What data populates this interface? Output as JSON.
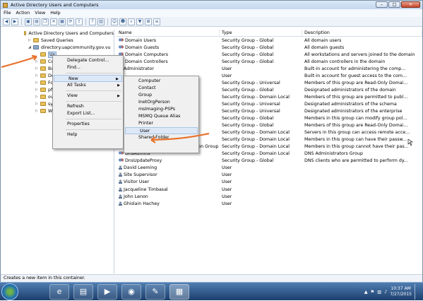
{
  "window": {
    "title": "Active Directory Users and Computers",
    "btn_min": "–",
    "btn_max": "□",
    "btn_close": "✕"
  },
  "menubar": [
    "File",
    "Action",
    "View",
    "Help"
  ],
  "toolbar_icons": [
    "back-icon",
    "forward-icon",
    "up-icon",
    "console-tree-icon",
    "copy-icon",
    "delete-icon",
    "properties-icon",
    "refresh-icon",
    "export-icon",
    "help-icon",
    "view-icon",
    "users-icon",
    "group-icon",
    "filter-icon",
    "find-icon",
    "add-to-group-icon"
  ],
  "tree": {
    "root": "Active Directory Users and Computers",
    "saved": "Saved Queries",
    "domain": "directory.uapcommunity.gov.vu",
    "selected": "Us",
    "children": [
      "Co",
      "Bu",
      "Do",
      "Fo",
      "pf",
      "ov",
      "sy",
      "W"
    ]
  },
  "columns": {
    "name": "Name",
    "type": "Type",
    "description": "Description"
  },
  "rows": [
    {
      "name": "Domain Users",
      "type": "Security Group - Global",
      "desc": "All domain users",
      "icon": "group"
    },
    {
      "name": "Domain Guests",
      "type": "Security Group - Global",
      "desc": "All domain guests",
      "icon": "group"
    },
    {
      "name": "Domain Computers",
      "type": "Security Group - Global",
      "desc": "All workstations and servers joined to the domain",
      "icon": "group"
    },
    {
      "name": "Domain Controllers",
      "type": "Security Group - Global",
      "desc": "All domain controllers in the domain",
      "icon": "group"
    },
    {
      "name": "Administrator",
      "type": "User",
      "desc": "Built-in account for administering the comp...",
      "icon": "user"
    },
    {
      "name": "",
      "type": "User",
      "desc": "Built-in account for guest access to the com...",
      "icon": "user"
    },
    {
      "name": "llers",
      "type": "Security Group - Universal",
      "desc": "Members of this group are Read-Only Domai...",
      "icon": "group"
    },
    {
      "name": "",
      "type": "Security Group - Global",
      "desc": "Designated administrators of the domain",
      "icon": "group"
    },
    {
      "name": "",
      "type": "Security Group - Domain Local",
      "desc": "Members of this group are permitted to publ...",
      "icon": "group"
    },
    {
      "name": "",
      "type": "Security Group - Universal",
      "desc": "Designated administrators of the schema",
      "icon": "group"
    },
    {
      "name": "",
      "type": "Security Group - Universal",
      "desc": "Designated administrators of the enterprise",
      "icon": "group"
    },
    {
      "name": "",
      "type": "Security Group - Global",
      "desc": "Members in this group can modify group pol...",
      "icon": "group"
    },
    {
      "name": "",
      "type": "Security Group - Global",
      "desc": "Members of this group are Read-Only Domai...",
      "icon": "group"
    },
    {
      "name": "",
      "type": "Security Group - Domain Local",
      "desc": "Servers in this group can access remote acce...",
      "icon": "group"
    },
    {
      "name": "Group",
      "type": "Security Group - Domain Local",
      "desc": "Members in this group can have their passw...",
      "icon": "group"
    },
    {
      "name": "Denied RODC Password Replication Group",
      "type": "Security Group - Domain Local",
      "desc": "Members in this group cannot have their pas...",
      "icon": "group"
    },
    {
      "name": "DnsAdmins",
      "type": "Security Group - Domain Local",
      "desc": "DNS Administrators Group",
      "icon": "group"
    },
    {
      "name": "DnsUpdateProxy",
      "type": "Security Group - Global",
      "desc": "DNS clients who are permitted to perform dy...",
      "icon": "group"
    },
    {
      "name": "David Leeming",
      "type": "User",
      "desc": "",
      "icon": "user"
    },
    {
      "name": "Site Supervisor",
      "type": "User",
      "desc": "",
      "icon": "user"
    },
    {
      "name": "Visitor User",
      "type": "User",
      "desc": "",
      "icon": "user"
    },
    {
      "name": "Jacqueline Timbasal",
      "type": "User",
      "desc": "",
      "icon": "user"
    },
    {
      "name": "John Lenon",
      "type": "User",
      "desc": "",
      "icon": "user"
    },
    {
      "name": "Ghislain Hachey",
      "type": "User",
      "desc": "",
      "icon": "user"
    }
  ],
  "context_menu": {
    "items": [
      "Delegate Control...",
      "Find...",
      "New",
      "All Tasks",
      "View",
      "Refresh",
      "Export List...",
      "Properties",
      "Help"
    ]
  },
  "submenu": {
    "items": [
      "Computer",
      "Contact",
      "Group",
      "InetOrgPerson",
      "msImaging-PSPs",
      "MSMQ Queue Alias",
      "Printer",
      "User",
      "Shared Folder"
    ]
  },
  "status": "Creates a new item in this container.",
  "taskbar": {
    "time": "10:37 AM",
    "date": "7/27/2015"
  },
  "colors": {
    "annotation_arrow": "#e8732c",
    "taskbar": "#2a5288"
  }
}
